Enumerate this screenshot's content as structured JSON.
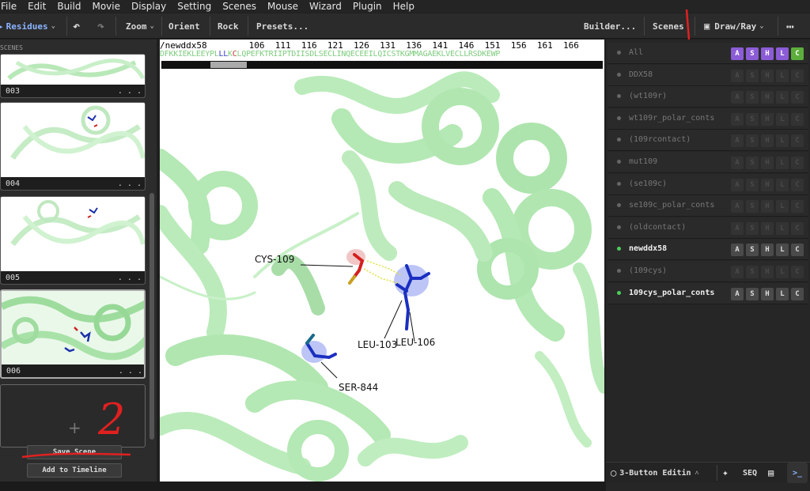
{
  "menu": [
    "File",
    "Edit",
    "Build",
    "Movie",
    "Display",
    "Setting",
    "Scenes",
    "Mouse",
    "Wizard",
    "Plugin",
    "Help"
  ],
  "toolbar": {
    "residues": "Residues",
    "zoom": "Zoom",
    "orient": "Orient",
    "rock": "Rock",
    "presets": "Presets...",
    "builder": "Builder...",
    "scenes": "Scenes",
    "drawray": "Draw/Ray",
    "more": "⋯"
  },
  "left_panel": {
    "title": "SCENES",
    "scenes": [
      {
        "label": "003",
        "menu": ". . ."
      },
      {
        "label": "004",
        "menu": ". . ."
      },
      {
        "label": "005",
        "menu": ". . ."
      },
      {
        "label": "006",
        "menu": ". . ."
      }
    ],
    "add": "+",
    "save_scene": "Save Scene",
    "add_timeline": "Add to Timeline"
  },
  "sequence": {
    "object": "/newddx58",
    "numbers": [
      "106",
      "111",
      "116",
      "121",
      "126",
      "131",
      "136",
      "141",
      "146",
      "151",
      "156",
      "161",
      "166"
    ],
    "residues": "DFKKIEKLEEYPLLLKCLQPEFKTRIIPTDIISDLSECLINQECEEILQICSTKGMMAGAEKLVECLLRSDKEWP"
  },
  "viewer_labels": {
    "cys": "CYS-109",
    "leu103": "LEU-103",
    "leu106": "LEU-106",
    "ser": "SER-844"
  },
  "objects": [
    {
      "name": "All",
      "on": false,
      "all": true
    },
    {
      "name": "DDX58",
      "on": false
    },
    {
      "name": "(wt109r)",
      "on": false
    },
    {
      "name": "wt109r_polar_conts",
      "on": false
    },
    {
      "name": "(109rcontact)",
      "on": false
    },
    {
      "name": "mut109",
      "on": false
    },
    {
      "name": "(se109c)",
      "on": false
    },
    {
      "name": "se109c_polar_conts",
      "on": false
    },
    {
      "name": "(oldcontact)",
      "on": false
    },
    {
      "name": "newddx58",
      "on": true
    },
    {
      "name": "(109cys)",
      "on": false
    },
    {
      "name": "109cys_polar_conts",
      "on": true
    }
  ],
  "obj_buttons": [
    "A",
    "S",
    "H",
    "L",
    "C"
  ],
  "bottom_bar": {
    "mouse_mode": "3-Button Editin",
    "seq": "SEQ",
    "prompt": ">_"
  },
  "annotations": {
    "two": "2"
  },
  "colors": {
    "accent_purple": "#8b5cd6",
    "accent_green": "#5cae3c",
    "cartoon": "#a8e6a8",
    "annotation_red": "#e02020"
  }
}
